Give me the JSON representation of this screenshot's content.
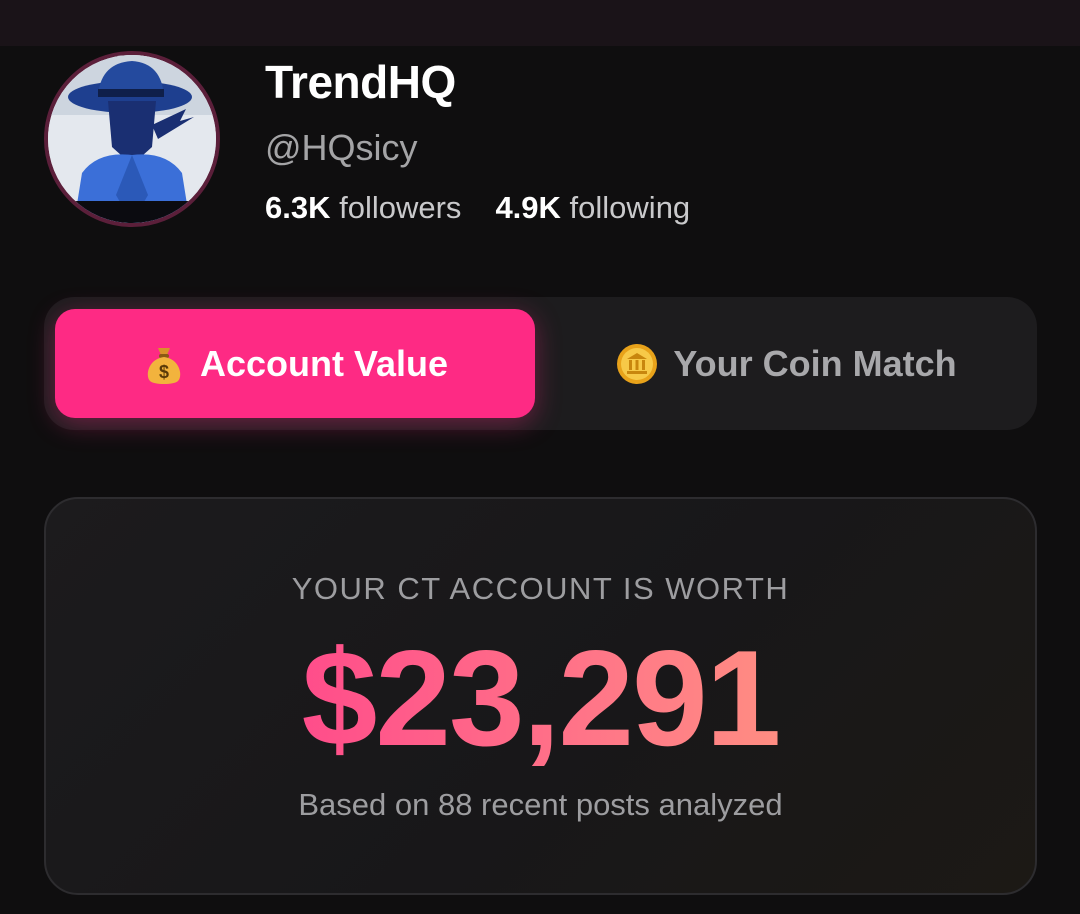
{
  "profile": {
    "name": "TrendHQ",
    "handle": "@HQsicy",
    "followers_count": "6.3K",
    "followers_label": "followers",
    "following_count": "4.9K",
    "following_label": "following"
  },
  "tabs": [
    {
      "label": "Account Value",
      "icon": "money-bag-icon",
      "active": true
    },
    {
      "label": "Your Coin Match",
      "icon": "coin-icon",
      "active": false
    }
  ],
  "value_card": {
    "caption": "YOUR CT ACCOUNT IS WORTH",
    "amount": "$23,291",
    "note": "Based on 88 recent posts analyzed"
  },
  "colors": {
    "accent": "#fe2a84",
    "background": "#0f0e0f",
    "amount_gradient_start": "#ff3e8c",
    "amount_gradient_end": "#ffa07c"
  }
}
